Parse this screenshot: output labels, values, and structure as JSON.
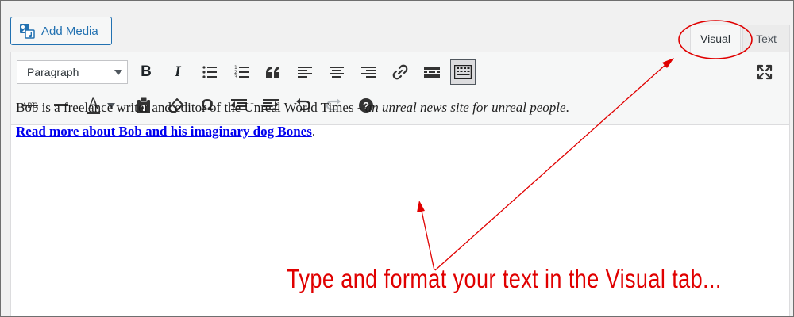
{
  "header": {
    "add_media_label": "Add Media"
  },
  "tabs": [
    {
      "label": "Visual",
      "selected": true
    },
    {
      "label": "Text",
      "selected": false
    }
  ],
  "toolbar": {
    "format_select_value": "Paragraph",
    "row1_icons": [
      "bold-icon",
      "italic-icon",
      "bulleted-list-icon",
      "numbered-list-icon",
      "blockquote-icon",
      "align-left-icon",
      "align-center-icon",
      "align-right-icon",
      "link-icon",
      "read-more-icon",
      "toolbar-toggle-icon"
    ],
    "row2_icons": [
      "strikethrough-icon",
      "horizontal-line-icon",
      "text-color-icon",
      "paste-as-text-icon",
      "clear-formatting-icon",
      "special-character-icon",
      "outdent-icon",
      "indent-icon",
      "undo-icon",
      "redo-icon",
      "help-icon"
    ],
    "bold_label": "B",
    "italic_label": "I",
    "strike_label": "ABC",
    "textcolor_label": "A",
    "omega_label": "Ω",
    "help_label": "?"
  },
  "content": {
    "text_plain": "Bob is a freelance writer and editor of the Unreal World Times - ",
    "text_italic": "an unreal news site for unreal people",
    "text_period": ".",
    "link_text": "Read more about Bob and his imaginary dog Bones",
    "link_period": "."
  },
  "annotation": {
    "text": "Type and format your text in the Visual tab...",
    "color": "#e00000"
  },
  "colors": {
    "accent": "#2271b1",
    "link": "#0000ee",
    "annotation": "#e00000"
  }
}
